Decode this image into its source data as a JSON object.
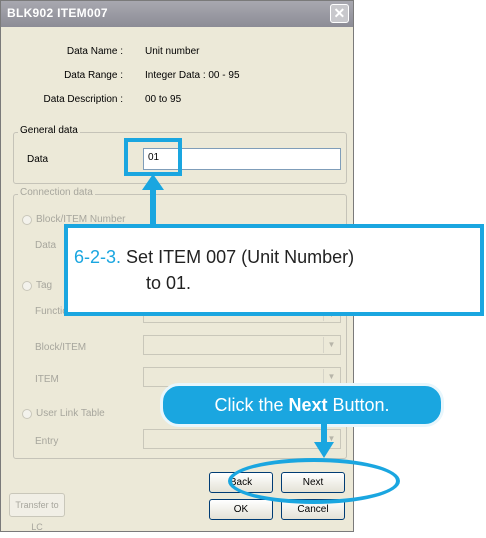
{
  "window": {
    "title": "BLK902 ITEM007",
    "close_glyph": "✕"
  },
  "info": {
    "name_label": "Data Name :",
    "name_value": "Unit number",
    "range_label": "Data Range :",
    "range_value": "Integer Data : 00 - 95",
    "desc_label": "Data Description :",
    "desc_value": "00 to 95"
  },
  "general": {
    "title": "General data",
    "data_label": "Data",
    "data_value": "01"
  },
  "connection": {
    "title": "Connection data",
    "block_item_number": "Block/ITEM Number",
    "data_label": "Data",
    "tag_label": "Tag",
    "function_label": "Function",
    "block_item_label": "Block/ITEM",
    "item_label": "ITEM",
    "user_link_table": "User Link Table",
    "entry_label": "Entry"
  },
  "buttons": {
    "back": "Back",
    "next": "Next",
    "ok": "OK",
    "cancel": "Cancel",
    "transfer": "Transfer to LC"
  },
  "annotation": {
    "step_number": "6-2-3.",
    "step_text_line1": "Set ITEM 007 (Unit Number)",
    "step_text_line2": "to 01.",
    "click_prefix": "Click the ",
    "click_bold": "Next",
    "click_suffix": " Button.",
    "accent_color": "#1aa6e0"
  }
}
